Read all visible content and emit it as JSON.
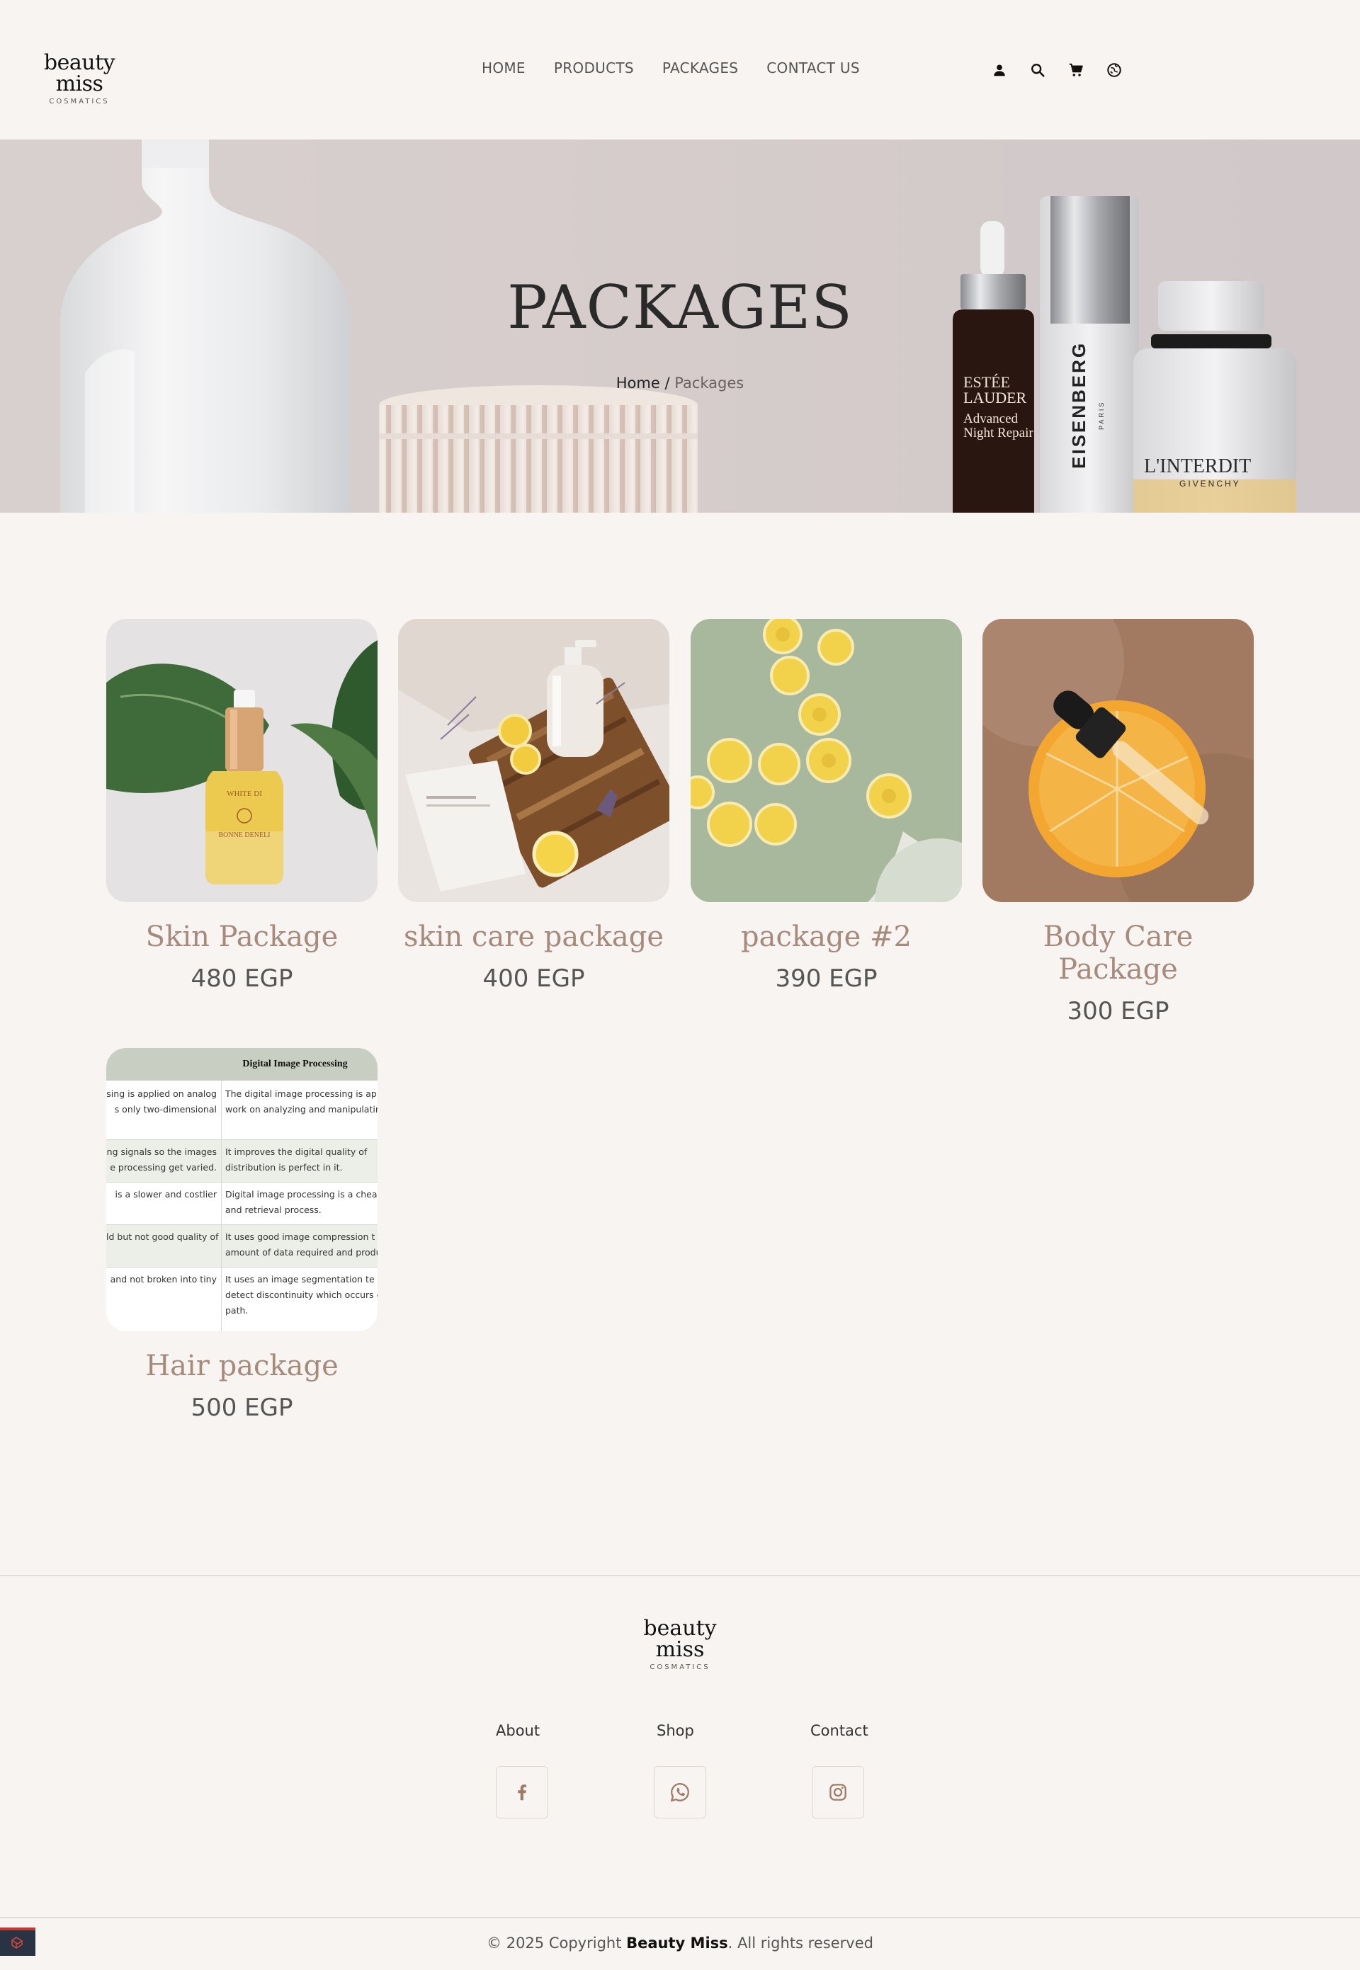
{
  "header": {
    "logo": {
      "brand": "beauty miss",
      "sub": "COSMATICS"
    },
    "nav": [
      {
        "label": "HOME"
      },
      {
        "label": "PRODUCTS"
      },
      {
        "label": "PACKAGES"
      },
      {
        "label": "CONTACT US"
      }
    ],
    "icons": [
      "user-icon",
      "search-icon",
      "cart-icon",
      "language-icon"
    ]
  },
  "hero": {
    "title": "PACKAGES",
    "breadcrumb": {
      "home": "Home",
      "separator": "/",
      "current": "Packages"
    },
    "bottle_text": {
      "brand1": "ESTÉE",
      "brand1b": "LAUDER",
      "line1": "Advanced",
      "line2": "Night Repair",
      "brand2": "EISENBERG",
      "brand2sub": "PARIS",
      "brand3": "L'INTERDIT",
      "brand3sub": "GIVENCHY"
    }
  },
  "products": [
    {
      "name": "Skin Package",
      "price": "480 EGP"
    },
    {
      "name": "skin care package",
      "price": "400 EGP"
    },
    {
      "name": "package #2",
      "price": "390 EGP"
    },
    {
      "name": "Body Care Package",
      "price": "300 EGP"
    },
    {
      "name": "Hair package",
      "price": "500 EGP"
    }
  ],
  "hair_image_table": {
    "title": "Digital Image Processing",
    "rows": [
      [
        "sing is applied on analog",
        "The digital image processing is app"
      ],
      [
        "s only two-dimensional",
        "work on analyzing and manipulating"
      ],
      [
        "ng signals so the images",
        "It improves the digital quality of"
      ],
      [
        "e processing get varied.",
        "distribution is perfect in it."
      ],
      [
        "is a slower and costlier",
        "Digital image processing is a cheap"
      ],
      [
        "",
        "and retrieval process."
      ],
      [
        "ld but not good quality of",
        "It uses good image compression t"
      ],
      [
        "",
        "amount of data required and produ"
      ],
      [
        "and not broken into tiny",
        "It uses an image segmentation te"
      ],
      [
        "",
        "detect discontinuity which occurs d"
      ],
      [
        "",
        "path."
      ]
    ]
  },
  "footer": {
    "logo": {
      "brand": "beauty miss",
      "sub": "COSMATICS"
    },
    "links": [
      "About",
      "Shop",
      "Contact"
    ],
    "social": [
      "facebook-icon",
      "whatsapp-icon",
      "instagram-icon"
    ],
    "copyright": {
      "prefix": "© 2025 Copyright ",
      "brand": "Beauty Miss",
      "suffix": ". All rights reserved"
    }
  }
}
